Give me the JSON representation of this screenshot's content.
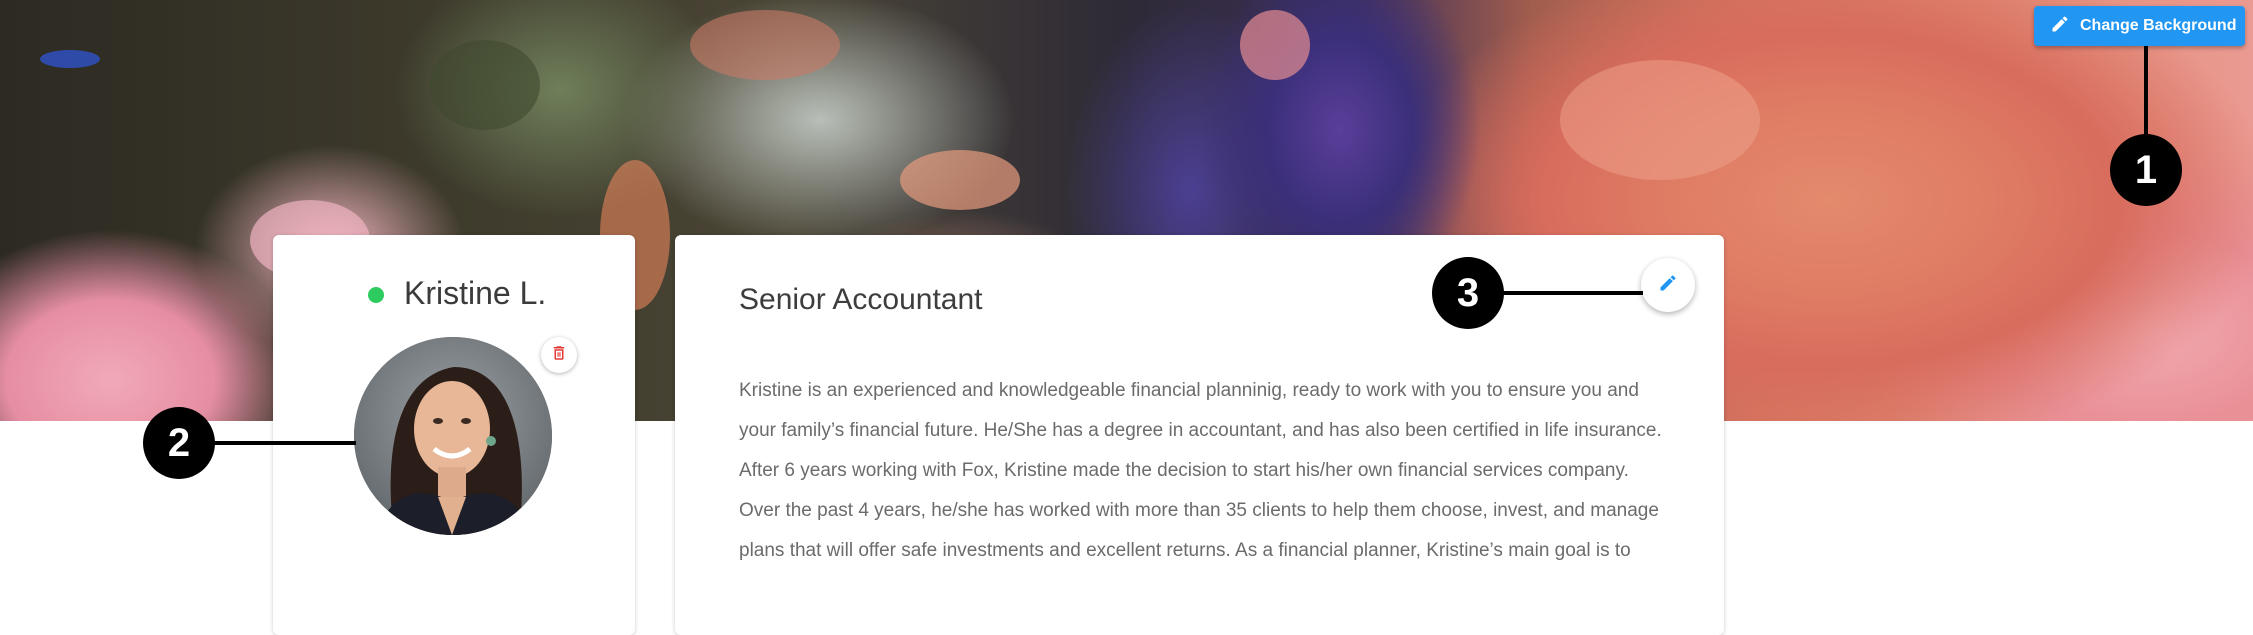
{
  "header": {
    "change_background_label": "Change Background",
    "change_background_icon": "pencil-icon",
    "button_color": "#2196f3"
  },
  "callouts": [
    "1",
    "2",
    "3"
  ],
  "profile": {
    "name": "Kristine L.",
    "status": "online",
    "status_color": "#2ecc5f",
    "delete_icon": "trash-icon",
    "delete_icon_color": "#e53935"
  },
  "bio": {
    "title": "Senior Accountant",
    "edit_icon": "pencil-icon",
    "edit_icon_color": "#2196f3",
    "lines": [
      "Kristine is an experienced and knowledgeable financial planninig, ready to work with you to ensure you and",
      "your family’s financial future. He/She has a degree in accountant, and has also been certified in life insurance.",
      "After 6 years working with Fox, Kristine made the decision to start his/her own financial services company.",
      "Over the past 4 years, he/she has worked with more than 35 clients to help them choose, invest, and manage",
      "plans that will offer safe investments and excellent returns. As a financial planner, Kristine’s main goal is to"
    ]
  }
}
